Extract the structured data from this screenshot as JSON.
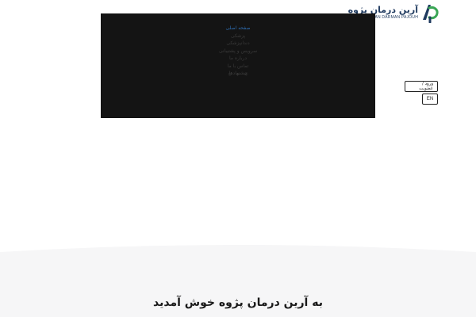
{
  "brand": {
    "name_fa": "آرین درمان پژوه",
    "name_en": "ARIAN DARMAN PAJOUH",
    "colors": {
      "blue": "#1f3a5f",
      "green": "#3aa655"
    }
  },
  "menu": {
    "items": [
      {
        "label": "صفحه اصلی",
        "active": true
      },
      {
        "label": "پزشکی",
        "active": false
      },
      {
        "label": "دندانپزشکی",
        "active": false
      },
      {
        "label": "سرویس و پشتیبانی",
        "active": false
      },
      {
        "label": "درباره ما",
        "active": false
      },
      {
        "label": "تماس با ما",
        "active": false
      },
      {
        "label": "پیشنهادها",
        "active": false
      }
    ],
    "socials": [
      "instagram-icon",
      "telegram-icon",
      "whatsapp-icon"
    ],
    "active_color": "#2f6fb5"
  },
  "auth": {
    "label": "ورود / عضویت"
  },
  "language": {
    "label": "EN"
  },
  "hero": {
    "welcome": "به آرین درمان پژوه خوش آمدید"
  }
}
